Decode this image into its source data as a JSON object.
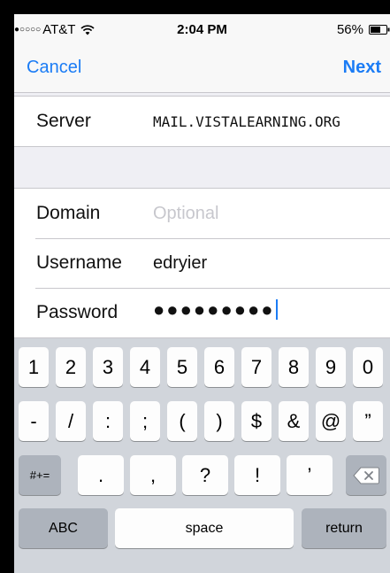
{
  "status_bar": {
    "signal": "●○○○○",
    "carrier": "AT&T",
    "time": "2:04 PM",
    "battery": "56%",
    "icons": {
      "wifi": "wifi-icon",
      "battery": "battery-icon"
    }
  },
  "nav": {
    "cancel_label": "Cancel",
    "next_label": "Next",
    "accent_color": "#1b7cf5"
  },
  "form": {
    "server": {
      "label": "Server",
      "value": "MAIL.VISTALEARNING.ORG"
    },
    "domain": {
      "label": "Domain",
      "placeholder": "Optional",
      "value": ""
    },
    "username": {
      "label": "Username",
      "value": "edryier"
    },
    "password": {
      "label": "Password",
      "masked_value": "●●●●●●●●●"
    }
  },
  "keyboard": {
    "row1": [
      "1",
      "2",
      "3",
      "4",
      "5",
      "6",
      "7",
      "8",
      "9",
      "0"
    ],
    "row2": [
      "-",
      "/",
      ":",
      ";",
      "(",
      ")",
      "$",
      "&",
      "@",
      "”"
    ],
    "row3": {
      "shift_label": "#+=",
      "keys": [
        ".",
        ",",
        "?",
        "!",
        "’"
      ],
      "delete_icon": "delete-icon"
    },
    "row4": {
      "abc_label": "ABC",
      "space_label": "space",
      "return_label": "return"
    }
  }
}
